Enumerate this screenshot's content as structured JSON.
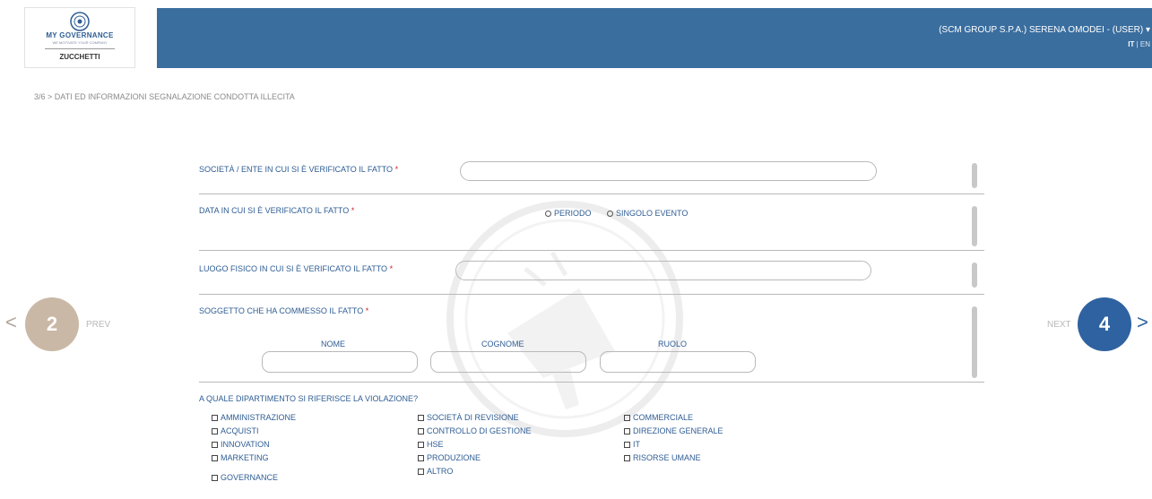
{
  "logo": {
    "brand": "MY GOVERNANCE",
    "tagline": "WE MOTIVATE YOUR COMPANY",
    "company": "ZUCCHETTI"
  },
  "header": {
    "user": "(SCM GROUP S.P.A.) SERENA OMODEI - (USER)",
    "lang_active": "IT",
    "lang_sep": "|",
    "lang_other": "EN",
    "color": "#3a6e9f"
  },
  "breadcrumb": "3/6 > DATI ED INFORMAZIONI SEGNALAZIONE CONDOTTA ILLECITA",
  "nav": {
    "prev_arrow": "<",
    "prev_number": "2",
    "prev_label": "PREV",
    "next_label": "NEXT",
    "next_number": "4",
    "next_arrow": ">"
  },
  "form": {
    "required_mark": "*",
    "company_label": "SOCIETÀ / ENTE IN CUI SI È VERIFICATO IL FATTO",
    "company_value": "",
    "date_label": "DATA IN CUI SI È VERIFICATO IL FATTO",
    "date_options": [
      "PERIODO",
      "SINGOLO EVENTO"
    ],
    "place_label": "LUOGO FISICO IN CUI SI È VERIFICATO IL FATTO",
    "place_value": "",
    "subject_label": "SOGGETTO CHE HA COMMESSO IL FATTO",
    "subject_columns": [
      "NOME",
      "COGNOME",
      "RUOLO"
    ],
    "department_label": "A QUALE DIPARTIMENTO SI RIFERISCE LA VIOLAZIONE?",
    "departments": {
      "col1": [
        "AMMINISTRAZIONE",
        "ACQUISTI",
        "INNOVATION",
        "MARKETING",
        "GOVERNANCE"
      ],
      "col2": [
        "SOCIETÀ DI REVISIONE",
        "CONTROLLO DI GESTIONE",
        "HSE",
        "PRODUZIONE",
        "ALTRO"
      ],
      "col3": [
        "COMMERCIALE",
        "DIREZIONE GENERALE",
        "IT",
        "RISORSE UMANE"
      ]
    }
  }
}
